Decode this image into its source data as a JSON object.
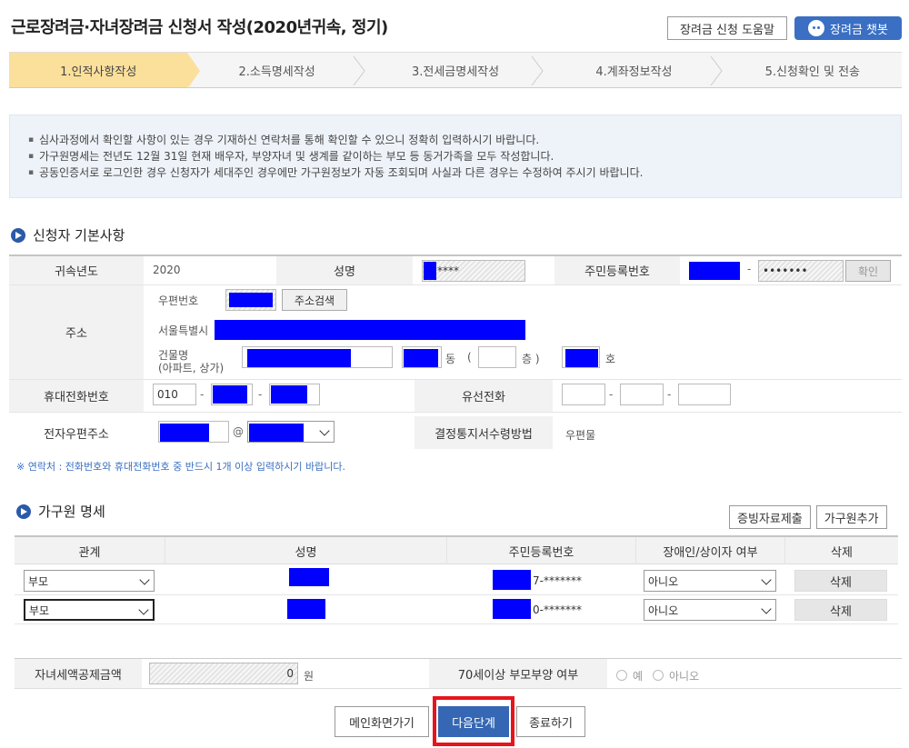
{
  "header": {
    "title": "근로장려금·자녀장려금 신청서 작성(2020년귀속, 정기)",
    "help_label": "장려금 신청 도움말",
    "chatbot_label": "장려금 챗봇"
  },
  "steps": [
    {
      "label": "1.인적사항작성",
      "active": true
    },
    {
      "label": "2.소득명세작성",
      "active": false
    },
    {
      "label": "3.전세금명세작성",
      "active": false
    },
    {
      "label": "4.계좌정보작성",
      "active": false
    },
    {
      "label": "5.신청확인 및 전송",
      "active": false
    }
  ],
  "notice": [
    "심사과정에서 확인할 사항이 있는 경우 기재하신 연락처를 통해 확인할 수 있으니 정확히 입력하시기 바랍니다.",
    "가구원명세는 전년도 12월 31일 현재 배우자, 부양자녀 및 생계를 같이하는 부모 등 동거가족을 모두 작성합니다.",
    "공동인증서로 로그인한 경우 신청자가 세대주인 경우에만 가구원정보가 자동 조회되며 사실과 다른 경우는 수정하여 주시기 바랍니다."
  ],
  "applicant": {
    "section_title": "신청자 기본사항",
    "year_label": "귀속년도",
    "year_value": "2020",
    "name_label": "성명",
    "name_value": "****",
    "ssn_label": "주민등록번호",
    "ssn_back": "•••••••",
    "confirm_label": "확인",
    "address_label": "주소",
    "zip_label": "우편번호",
    "address_search_label": "주소검색",
    "city": "서울특별시",
    "building_label": "건물명",
    "building_sub": "(아파트, 상가)",
    "dong_label": "동",
    "floor_open": "(",
    "floor_label": "층 )",
    "ho_label": "호",
    "mobile_label": "휴대전화번호",
    "mobile_prefix": "010",
    "landline_label": "유선전화",
    "email_label": "전자우편주소",
    "email_at": "@",
    "notice_method_label": "결정통지서수령방법",
    "notice_method_value": "우편물",
    "contact_note": "※ 연락처 : 전화번호와 휴대전화번호 중 반드시 1개 이상 입력하시기 바랍니다.",
    "dash": "-"
  },
  "family": {
    "section_title": "가구원 명세",
    "evidence_label": "증빙자료제출",
    "add_label": "가구원추가",
    "columns": [
      "관계",
      "성명",
      "주민등록번호",
      "장애인/상이자 여부",
      "삭제"
    ],
    "rows": [
      {
        "relation": "부모",
        "ssn_tail": "7-*******",
        "disabled": "아니오",
        "delete_label": "삭제"
      },
      {
        "relation": "부모",
        "ssn_tail": "0-*******",
        "disabled": "아니오",
        "delete_label": "삭제"
      }
    ]
  },
  "bottom": {
    "child_credit_label": "자녀세액공제금액",
    "child_credit_value": "0",
    "unit": "원",
    "elderly_label": "70세이상 부모부양 여부",
    "yes_label": "예",
    "no_label": "아니오"
  },
  "actions": {
    "main_label": "메인화면가기",
    "next_label": "다음단계",
    "exit_label": "종료하기"
  },
  "colors": {
    "accent": "#3567b5",
    "active_step": "#fbe09c",
    "redaction": "#0000ff",
    "highlight": "#e8141c"
  }
}
